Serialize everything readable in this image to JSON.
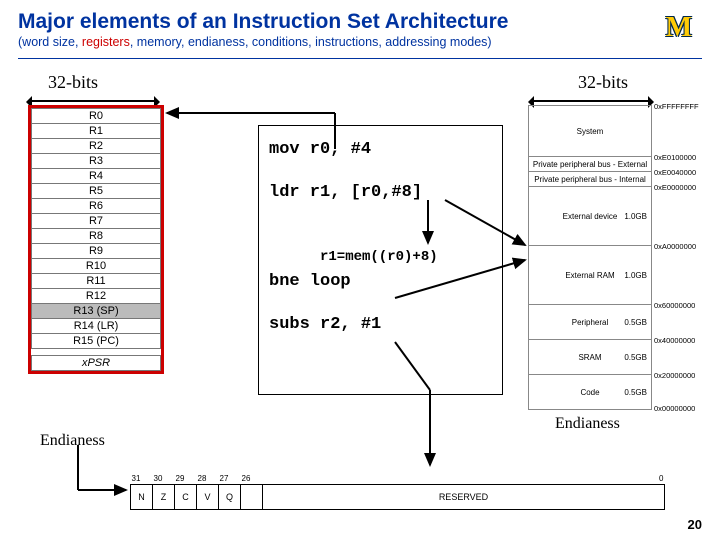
{
  "title": "Major elements of an Instruction Set Architecture",
  "subtitle_pre": "(word size, ",
  "subtitle_red": "registers",
  "subtitle_post": ", memory, endianess, conditions, instructions, addressing modes)",
  "logo": "M",
  "labels": {
    "bits_left": "32-bits",
    "bits_right": "32-bits",
    "end_left": "Endianess",
    "end_right": "Endianess"
  },
  "registers": [
    "R0",
    "R1",
    "R2",
    "R3",
    "R4",
    "R5",
    "R6",
    "R7",
    "R8",
    "R9",
    "R10",
    "R11",
    "R12",
    "R13 (SP)",
    "R14 (LR)",
    "R15 (PC)",
    "xPSR"
  ],
  "code": {
    "l1": "mov r0, #4",
    "l2": "ldr r1, [r0,#8]",
    "l3": "bne loop",
    "l4": "subs r2, #1"
  },
  "note": "r1=mem((r0)+8)",
  "memory": [
    {
      "n": "System",
      "h": 50,
      "adr": "0xFFFFFFFF"
    },
    {
      "n": "Private peripheral bus - External",
      "h": 14,
      "adr": "0xE0100000"
    },
    {
      "n": "Private peripheral bus - Internal",
      "h": 14,
      "adr": "0xE0040000"
    },
    {
      "n": "External device  1.0GB",
      "h": 60,
      "adr": "0xE0000000",
      "sz": "1.0GB"
    },
    {
      "n": "External RAM  1.0GB",
      "h": 60,
      "adr": "0xA0000000",
      "sz": "1.0GB"
    },
    {
      "n": "Peripheral",
      "h": 34,
      "adr": "0x60000000",
      "sz": "0.5GB"
    },
    {
      "n": "SRAM",
      "h": 34,
      "adr": "0x40000000",
      "sz": "0.5GB"
    },
    {
      "n": "Code",
      "h": 34,
      "adr": "0x20000000",
      "sz": "0.5GB"
    }
  ],
  "mem_bottom_adr": "0x00000000",
  "psr_bits": [
    "31",
    "30",
    "29",
    "28",
    "27",
    "26",
    "",
    "0"
  ],
  "psr_cells": [
    "N",
    "Z",
    "C",
    "V",
    "Q",
    "",
    "RESERVED"
  ],
  "page": "20"
}
